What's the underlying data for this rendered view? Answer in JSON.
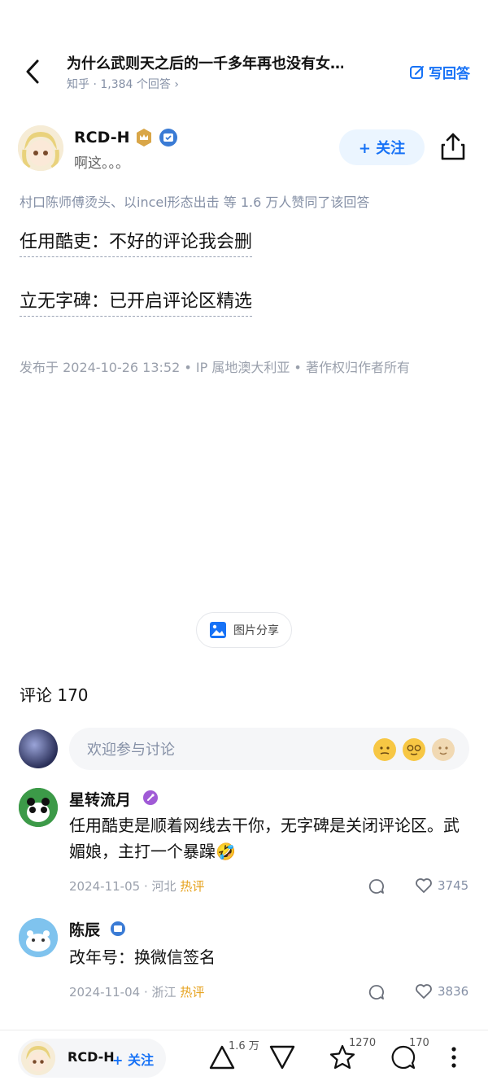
{
  "header": {
    "question_title": "为什么武则天之后的一千多年再也没有女…",
    "source": "知乎",
    "answer_count": "1,384 个回答",
    "write_answer": "写回答"
  },
  "author": {
    "name": "RCD-H",
    "bio": "啊这。。。",
    "follow_label": "+ 关注"
  },
  "likers_text": "村口陈师傅烫头、以incel形态出击 等 1.6 万人赞同了该回答",
  "answer_lines": [
    "任用酷吏：不好的评论我会删",
    "立无字碑：已开启评论区精选"
  ],
  "publish_info": "发布于 2024-10-26 13:52 • IP 属地澳大利亚 • 著作权归作者所有",
  "image_share_label": "图片分享",
  "comments": {
    "title": "评论 170",
    "input_placeholder": "欢迎参与讨论",
    "items": [
      {
        "name": "星转流月",
        "text": "任用酷吏是顺着网线去干你，无字碑是关闭评论区。武媚娘，主打一个暴躁🤣",
        "date": "2024-11-05",
        "location": "河北",
        "tag": "热评",
        "likes": "3745"
      },
      {
        "name": "陈辰",
        "text": "改年号：换微信签名",
        "date": "2024-11-04",
        "location": "浙江",
        "tag": "热评",
        "likes": "3836"
      }
    ]
  },
  "bottom_bar": {
    "author_name": "RCD-H",
    "follow_label": "+ 关注",
    "upvote_count": "1.6 万",
    "favorite_count": "1270",
    "comment_count": "170"
  },
  "colors": {
    "accent": "#1772f6",
    "hot": "#e6a21e",
    "muted": "#8590a6"
  },
  "icons": [
    "back-arrow-icon",
    "edit-icon",
    "crown-badge-icon",
    "verified-badge-icon",
    "share-icon",
    "image-icon",
    "reply-icon",
    "heart-icon",
    "upvote-icon",
    "downvote-icon",
    "star-icon",
    "comment-icon",
    "more-icon"
  ]
}
